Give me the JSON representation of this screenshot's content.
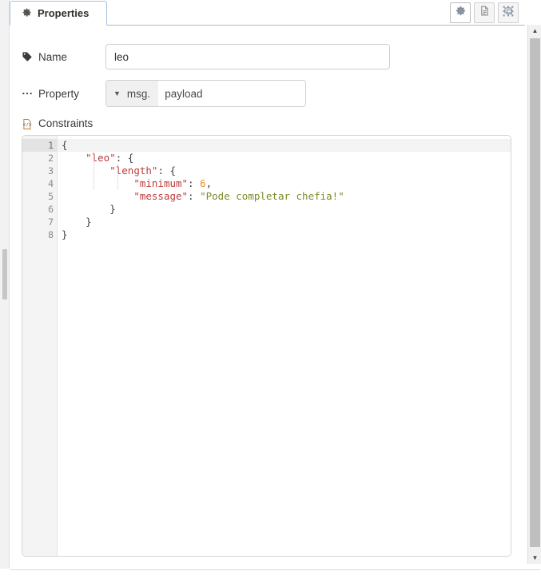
{
  "window": {
    "tab_label": "Properties",
    "tab_icon": "gear-icon"
  },
  "toolbar": {
    "buttons": [
      {
        "name": "properties-tab-button",
        "icon": "gear-icon",
        "active": true
      },
      {
        "name": "info-tab-button",
        "icon": "document-icon",
        "active": false
      },
      {
        "name": "layout-tab-button",
        "icon": "select-group-icon",
        "active": false
      }
    ]
  },
  "form": {
    "name_field": {
      "label": "Name",
      "icon": "tag-icon",
      "value": "leo",
      "placeholder": "Name"
    },
    "property_field": {
      "label": "Property",
      "icon": "ellipsis-icon",
      "select_value": "msg.",
      "value": "payload",
      "placeholder": "payload"
    },
    "constraints_section": {
      "label": "Constraints",
      "icon": "code-file-icon"
    }
  },
  "editor": {
    "active_line": 1,
    "lines": [
      {
        "number": "1",
        "fold": "▾",
        "tokens": [
          {
            "t": "{",
            "c": "p"
          }
        ]
      },
      {
        "number": "2",
        "fold": "▾",
        "tokens": [
          {
            "t": "    ",
            "c": "p"
          },
          {
            "t": "\"leo\"",
            "c": "k"
          },
          {
            "t": ": {",
            "c": "p"
          }
        ]
      },
      {
        "number": "3",
        "fold": "▾",
        "tokens": [
          {
            "t": "        ",
            "c": "p"
          },
          {
            "t": "\"length\"",
            "c": "k"
          },
          {
            "t": ": {",
            "c": "p"
          }
        ]
      },
      {
        "number": "4",
        "fold": "",
        "tokens": [
          {
            "t": "            ",
            "c": "p"
          },
          {
            "t": "\"minimum\"",
            "c": "k"
          },
          {
            "t": ": ",
            "c": "p"
          },
          {
            "t": "6",
            "c": "n"
          },
          {
            "t": ",",
            "c": "p"
          }
        ]
      },
      {
        "number": "5",
        "fold": "",
        "tokens": [
          {
            "t": "            ",
            "c": "p"
          },
          {
            "t": "\"message\"",
            "c": "k"
          },
          {
            "t": ": ",
            "c": "p"
          },
          {
            "t": "\"Pode completar chefia!\"",
            "c": "s"
          }
        ]
      },
      {
        "number": "6",
        "fold": "▴",
        "tokens": [
          {
            "t": "        }",
            "c": "p"
          }
        ]
      },
      {
        "number": "7",
        "fold": "▴",
        "tokens": [
          {
            "t": "    }",
            "c": "p"
          }
        ]
      },
      {
        "number": "8",
        "fold": "▴",
        "tokens": [
          {
            "t": "}",
            "c": "p"
          }
        ]
      }
    ]
  },
  "scrollbars": {
    "right": {
      "up_arrow": "▲",
      "down_arrow": "▼"
    }
  },
  "colors": {
    "tab_border": "#a8c0e0",
    "key": "#bf3b3b",
    "string": "#7e8b29",
    "number": "#e8912d",
    "punctuation": "#3d3d3d",
    "gutter_bg": "#f4f4f4",
    "active_line_bg": "#f3f3f3"
  }
}
